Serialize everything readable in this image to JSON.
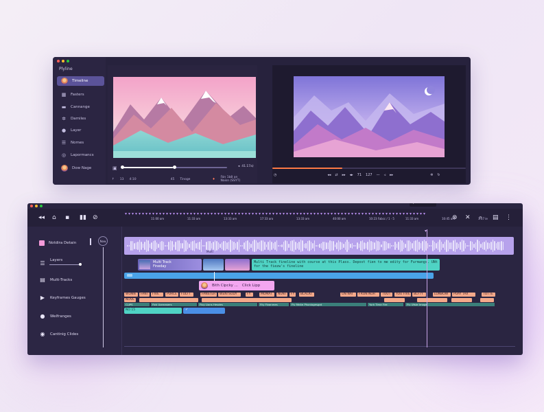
{
  "colors": {
    "accent": "#5b5399",
    "clip_lavender": "#b7a2ec",
    "teal": "#4fd3c4",
    "blue": "#4aa3e8",
    "tag_salmon": "#f4a98a",
    "dot_red": "#ff5f57",
    "dot_yellow": "#febc2e",
    "dot_green": "#28c840"
  },
  "sidebar": {
    "title": "Plyline",
    "items": [
      {
        "label": "Timeline",
        "icon": "avatar-icon",
        "active": true
      },
      {
        "label": "Fasters",
        "icon": "grid-icon"
      },
      {
        "label": "Cannange",
        "icon": "folder-icon"
      },
      {
        "label": "Damiles",
        "icon": "gear-icon"
      },
      {
        "label": "Layer",
        "icon": "user-icon"
      },
      {
        "label": "Nomes",
        "icon": "list-icon"
      },
      {
        "label": "Lapormancs",
        "icon": "compass-icon"
      },
      {
        "label": "Dow Nage",
        "icon": "avatar-icon"
      }
    ]
  },
  "left_preview": {
    "time_left": "13",
    "time_mid": "4:10",
    "counter": "41.17a)",
    "label_a": "Tinoge",
    "label_b": "Fán 1b8 an",
    "label_c": "Naisn (SSYT)",
    "label_num": "45",
    "progress": 0.6
  },
  "right_preview": {
    "progress": 0.6,
    "time_a": "71",
    "time_b": "127"
  },
  "timeline": {
    "tooltip": "1015",
    "ruler_labels": [
      "11:00 am",
      "11:33 am",
      "13:33 am",
      "17:33 aro",
      "13:33 am",
      "40:00 am",
      "10:23 Fabcc / 1 · 5",
      "11:33 am",
      "10:45 am",
      "1:37 ie"
    ],
    "now_label": "Now",
    "lanes": [
      {
        "label": "Notdira Detain",
        "icon": "swatch-icon"
      },
      {
        "label": "Layers",
        "icon": "layers-icon"
      },
      {
        "label": "Multi-Tracks",
        "icon": "tracks-icon"
      },
      {
        "label": "Keyframes Gauges",
        "icon": "play-icon"
      },
      {
        "label": "Welfranges",
        "icon": "circle-icon"
      },
      {
        "label": "Cantinig Clides",
        "icon": "clips-icon"
      }
    ],
    "title_clip": {
      "line1": "Multi Track",
      "line2": "Fineday"
    },
    "teal_clip_text": "Multi Track fineline with course at this Plass. Depost fien to me edity for Furmangs. UNt for the fiezw's fineline",
    "pink_clip": {
      "title": "Bith Cipcky ...",
      "action": "Click Lipp"
    },
    "wave_label": "Multi",
    "tags": [
      "WONN",
      "FANT",
      "FIVE",
      "PURCE",
      "FULFT",
      "FANSTER",
      "WENTSUDY",
      "FY",
      "MOMAT",
      "NUNT",
      "FY",
      "BLACKT",
      "ON NAT",
      "FRON NOR",
      "TOUT",
      "YOU FIVE",
      "BLFTY",
      "LONBOW",
      "PUAY TAX",
      "TOTTE",
      "NOVE"
    ],
    "sub_tags": [
      "CLIPS",
      "Fick Uonnasers",
      "Fiuy Lions Hesdes",
      "Fliy Fivanmes",
      "Flv Mnite Phoniogesgat",
      "Yurk Time Fire",
      "Flv Ufste Image"
    ],
    "teal_small": "NO 15"
  }
}
